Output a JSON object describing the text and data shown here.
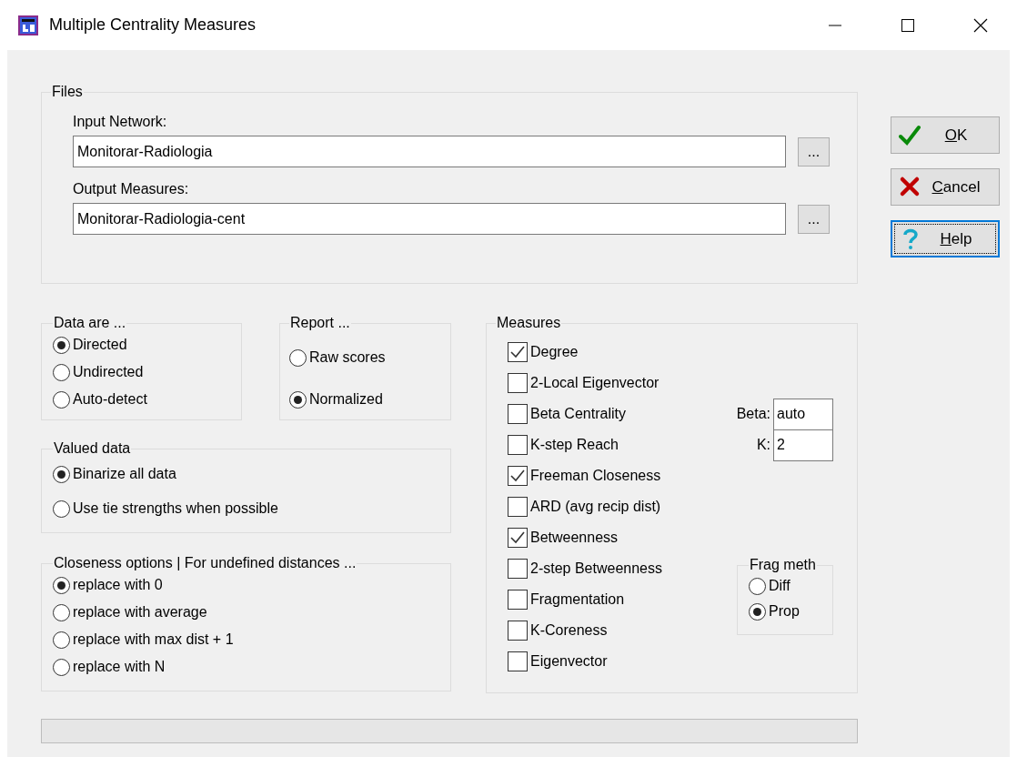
{
  "window": {
    "title": "Multiple Centrality Measures"
  },
  "files": {
    "label": "Files",
    "fields": [
      {
        "label": "Input Network:",
        "value": "Monitorar-Radiologia",
        "browse": "..."
      },
      {
        "label": "Output Measures:",
        "value": "Monitorar-Radiologia-cent",
        "browse": "..."
      }
    ]
  },
  "data_are": {
    "label": "Data are ...",
    "options": [
      {
        "label": "Directed",
        "selected": true
      },
      {
        "label": "Undirected",
        "selected": false
      },
      {
        "label": "Auto-detect",
        "selected": false
      }
    ]
  },
  "report": {
    "label": "Report ...",
    "options": [
      {
        "label": "Raw scores",
        "selected": false
      },
      {
        "label": "Normalized",
        "selected": true
      }
    ]
  },
  "valued_data": {
    "label": "Valued data",
    "options": [
      {
        "label": "Binarize all data",
        "selected": true
      },
      {
        "label": "Use tie strengths when possible",
        "selected": false
      }
    ]
  },
  "closeness_options": {
    "label": "Closeness options | For undefined distances ...",
    "options": [
      {
        "label": "replace with 0",
        "selected": true
      },
      {
        "label": "replace with average",
        "selected": false
      },
      {
        "label": "replace with max dist + 1",
        "selected": false
      },
      {
        "label": "replace with N",
        "selected": false
      }
    ]
  },
  "measures": {
    "label": "Measures",
    "items": [
      {
        "label": "Degree",
        "checked": true
      },
      {
        "label": "2-Local Eigenvector",
        "checked": false
      },
      {
        "label": "Beta Centrality",
        "checked": false
      },
      {
        "label": "K-step Reach",
        "checked": false
      },
      {
        "label": "Freeman Closeness",
        "checked": true
      },
      {
        "label": "ARD (avg recip dist)",
        "checked": false
      },
      {
        "label": "Betweenness",
        "checked": true
      },
      {
        "label": "2-step Betweenness",
        "checked": false
      },
      {
        "label": "Fragmentation",
        "checked": false
      },
      {
        "label": "K-Coreness",
        "checked": false
      },
      {
        "label": "Eigenvector",
        "checked": false
      }
    ],
    "beta": {
      "label": "Beta:",
      "value": "auto"
    },
    "k": {
      "label": "K:",
      "value": "2"
    },
    "frag_meth": {
      "label": "Frag meth",
      "options": [
        {
          "label": "Diff",
          "selected": false
        },
        {
          "label": "Prop",
          "selected": true
        }
      ]
    }
  },
  "buttons": [
    {
      "kind": "ok",
      "mnemonic": "O",
      "rest": "K",
      "focused": false
    },
    {
      "kind": "cancel",
      "mnemonic": "C",
      "rest": "ancel",
      "focused": false
    },
    {
      "kind": "help",
      "mnemonic": "H",
      "rest": "elp",
      "focused": true
    }
  ],
  "progress": {
    "level": 0
  }
}
